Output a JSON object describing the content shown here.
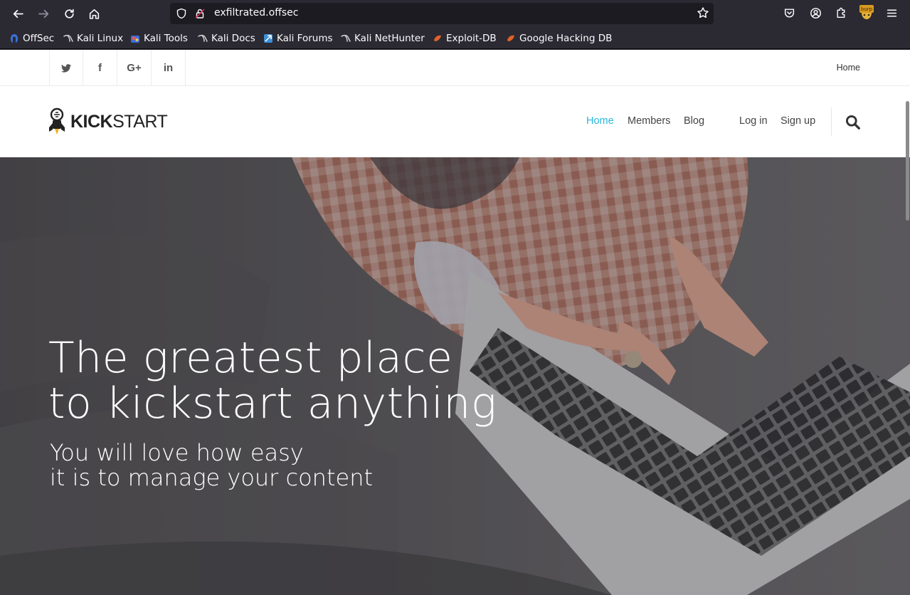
{
  "browser": {
    "url": "exfiltrated.offsec",
    "bookmarks": [
      {
        "label": "OffSec",
        "icon": "offsec-icon",
        "color": "#3b6fd8"
      },
      {
        "label": "Kali Linux",
        "icon": "kali-dragon-icon",
        "color": "#d0d0d0"
      },
      {
        "label": "Kali Tools",
        "icon": "kali-tools-icon",
        "color": "#e85a5a"
      },
      {
        "label": "Kali Docs",
        "icon": "kali-dragon-icon",
        "color": "#d0d0d0"
      },
      {
        "label": "Kali Forums",
        "icon": "kali-forums-icon",
        "color": "#3b8fd8"
      },
      {
        "label": "Kali NetHunter",
        "icon": "kali-dragon-icon",
        "color": "#d0d0d0"
      },
      {
        "label": "Exploit-DB",
        "icon": "exploit-db-icon",
        "color": "#e0622a"
      },
      {
        "label": "Google Hacking DB",
        "icon": "ghdb-icon",
        "color": "#e0622a"
      }
    ],
    "burp_label": "burp"
  },
  "site": {
    "social": [
      "twitter-icon",
      "facebook-icon",
      "google-plus-icon",
      "linkedin-icon"
    ],
    "social_glyphs": [
      "",
      "f",
      "G+",
      "in"
    ],
    "topbar_home": "Home",
    "logo": {
      "kick": "KICK",
      "start": "START"
    },
    "nav": {
      "home": "Home",
      "members": "Members",
      "blog": "Blog",
      "login": "Log in",
      "signup": "Sign up"
    },
    "accent_color": "#29b6d8",
    "hero": {
      "title_line1": "The greatest place",
      "title_line2": "to kickstart anything",
      "sub_line1": "You will love how easy",
      "sub_line2": "it is to manage your content"
    }
  }
}
